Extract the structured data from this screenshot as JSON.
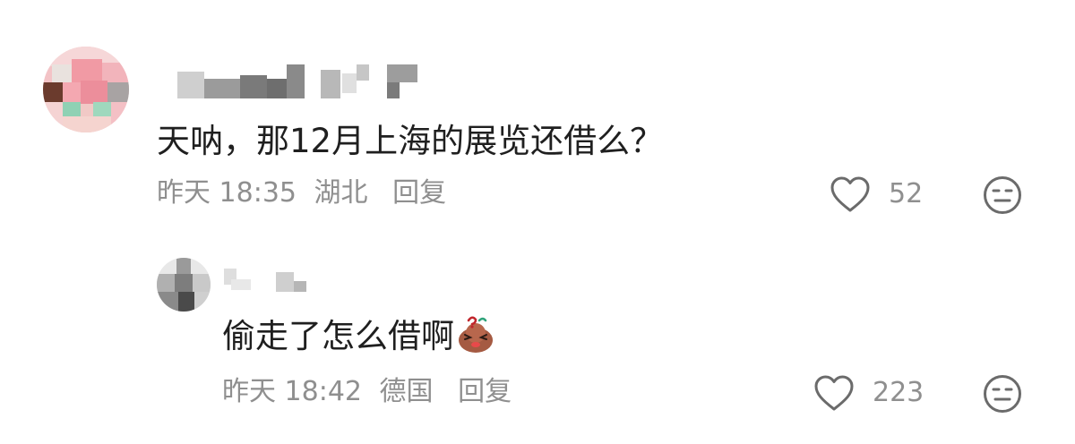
{
  "comments": [
    {
      "text": "天呐，那12月上海的展览还借么？",
      "time": "昨天 18:35",
      "location": "湖北",
      "reply_label": "回复",
      "likes": "52",
      "like_icon": "heart-outline-icon",
      "reaction_icon": "neutral-face-icon"
    },
    {
      "text": "偷走了怎么借啊",
      "emoji": "bean-emoji",
      "time": "昨天 18:42",
      "location": "德国",
      "reply_label": "回复",
      "likes": "223",
      "like_icon": "heart-outline-icon",
      "reaction_icon": "neutral-face-icon"
    }
  ],
  "colors": {
    "text": "#1f1f1f",
    "meta": "#8f8f8f",
    "icon": "#6b6b6b"
  }
}
